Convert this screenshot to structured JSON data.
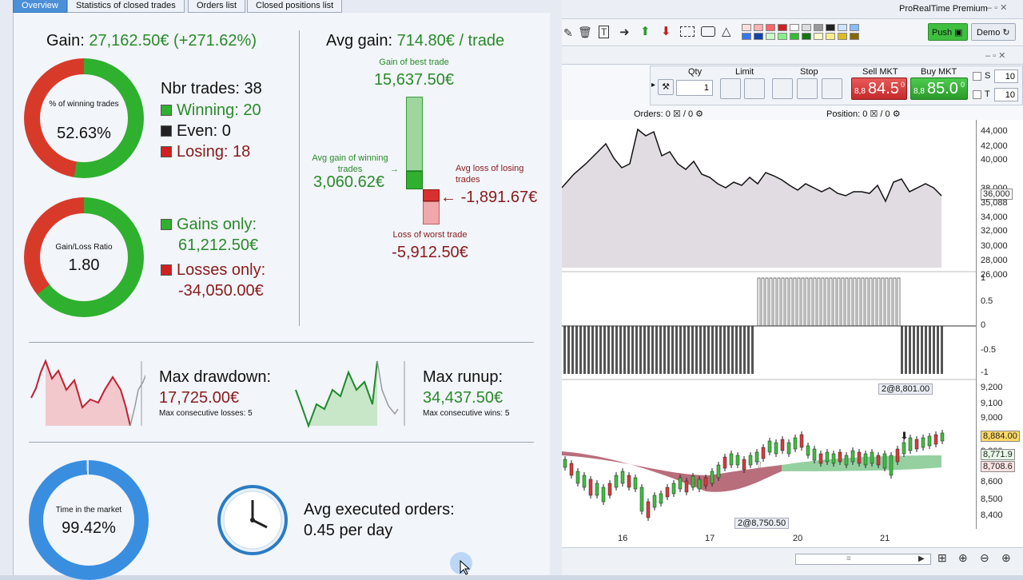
{
  "tabs": [
    "Overview",
    "Statistics of closed trades",
    "Orders list",
    "Closed positions list"
  ],
  "gain": {
    "label": "Gain:",
    "value": "27,162.50€ (+271.62%)"
  },
  "winning_ring": {
    "label": "% of winning trades",
    "value": "52.63%",
    "fraction": 0.5263
  },
  "trades": {
    "nbr": "Nbr trades: 38",
    "winning_label": "Winning:",
    "winning": "20",
    "even_label": "Even:",
    "even": "0",
    "losing_label": "Losing:",
    "losing": "18"
  },
  "gl_ring": {
    "label": "Gain/Loss Ratio",
    "value": "1.80"
  },
  "gains_only": {
    "label": "Gains only:",
    "value": "61,212.50€"
  },
  "losses_only": {
    "label": "Losses only:",
    "value": "-34,050.00€"
  },
  "avg_gain": {
    "label": "Avg gain:",
    "value": "714.80€ / trade"
  },
  "best_trade": {
    "label": "Gain of best trade",
    "value": "15,637.50€"
  },
  "avg_win": {
    "label": "Avg gain of winning trades",
    "value": "3,060.62€"
  },
  "avg_loss": {
    "label": "Avg loss of losing trades",
    "value": "-1,891.67€"
  },
  "worst_trade": {
    "label": "Loss of worst trade",
    "value": "-5,912.50€"
  },
  "drawdown": {
    "label": "Max drawdown:",
    "value": "17,725.00€",
    "sub": "Max consecutive losses: 5"
  },
  "runup": {
    "label": "Max runup:",
    "value": "34,437.50€",
    "sub": "Max consecutive wins: 5"
  },
  "market_ring": {
    "label": "Time in the market",
    "value": "99.42%",
    "fraction": 0.9942
  },
  "avg_orders": {
    "label": "Avg executed orders:",
    "value": "0.45 per day"
  },
  "app": {
    "title": "ProRealTime Premium",
    "push": "Push",
    "demo": "Demo"
  },
  "order_bar": {
    "qty_label": "Qty",
    "qty": "1",
    "limit": "Limit",
    "stop": "Stop",
    "sell_label": "Sell MKT",
    "sell_price": "84.5",
    "sell_prefix": "8,8",
    "sell_sup": "0",
    "buy_label": "Buy MKT",
    "buy_price": "85.0",
    "buy_prefix": "8,8",
    "buy_sup": "0",
    "s_label": "S",
    "s_value": "10",
    "t_label": "T",
    "t_value": "10"
  },
  "status": {
    "orders_label": "Orders:",
    "orders_a": "0",
    "orders_b": "/ 0",
    "position_label": "Position:",
    "position_a": "0",
    "position_b": "/ 0"
  },
  "equity_ticks": [
    "44,000",
    "42,000",
    "40,000",
    "38,000",
    "36,000",
    "35,088",
    "34,000",
    "32,000",
    "30,000",
    "28,000",
    "26,000"
  ],
  "pos_ticks": [
    "1",
    "0.5",
    "0",
    "-0.5",
    "-1"
  ],
  "price_ticks": [
    "9,200",
    "9,100",
    "9,000",
    "8,884.00",
    "8,800",
    "8,771.9",
    "8,708.6",
    "8,600",
    "8,500",
    "8,400"
  ],
  "price_annotations": [
    "2@8,801.00",
    "2@8,750.50"
  ],
  "date_ticks": [
    "16",
    "17",
    "20",
    "21"
  ],
  "colors": {
    "win": "#2a8a2a",
    "loss": "#8a1a1a",
    "accent": "#4b8fd6"
  }
}
